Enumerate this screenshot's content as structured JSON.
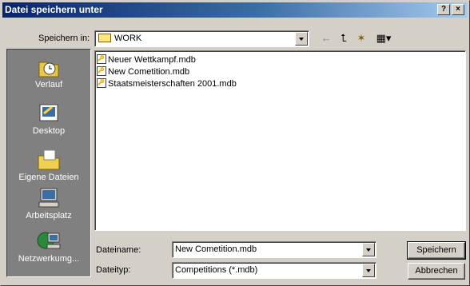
{
  "dialog": {
    "title": "Datei speichern unter",
    "help_label": "?",
    "close_label": "×"
  },
  "save_in": {
    "label": "Speichern in:",
    "value": "WORK"
  },
  "toolbar": {
    "back_icon": "←",
    "up_icon": "⮤",
    "new_folder_icon": "✶",
    "views_icon": "▦▾"
  },
  "places": [
    {
      "label": "Verlauf",
      "icon": "history-icon"
    },
    {
      "label": "Desktop",
      "icon": "desktop-icon"
    },
    {
      "label": "Eigene Dateien",
      "icon": "my-documents-icon"
    },
    {
      "label": "Arbeitsplatz",
      "icon": "my-computer-icon"
    },
    {
      "label": "Netzwerkumg...",
      "icon": "network-icon"
    }
  ],
  "files": [
    {
      "name": "Neuer Wettkampf.mdb"
    },
    {
      "name": "New Cometition.mdb"
    },
    {
      "name": "Staatsmeisterschaften 2001.mdb"
    }
  ],
  "filename": {
    "label": "Dateiname:",
    "value": "New Cometition.mdb"
  },
  "filetype": {
    "label": "Dateityp:",
    "value": "Competitions (*.mdb)"
  },
  "buttons": {
    "save": "Speichern",
    "cancel": "Abbrechen"
  }
}
